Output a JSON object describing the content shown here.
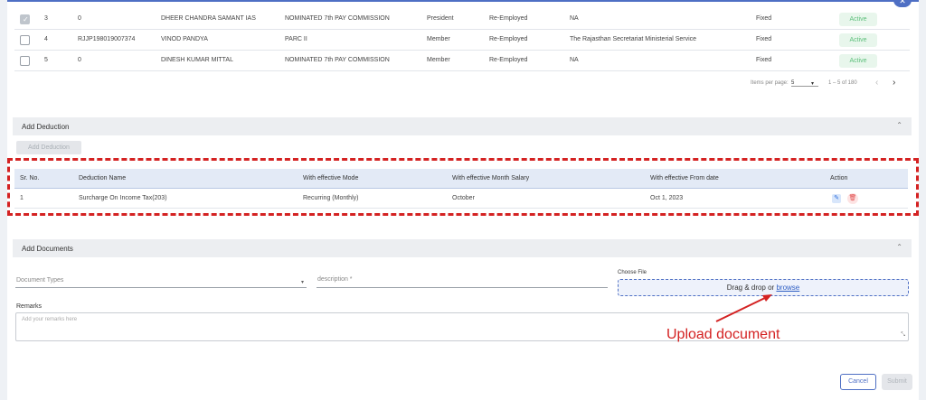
{
  "members_table": {
    "rows": [
      {
        "sr": "3",
        "id": "0",
        "name": "DHEER CHANDRA SAMANT IAS",
        "nominated": "NOMINATED 7th PAY COMMISSION",
        "role": "President",
        "employment": "Re-Employed",
        "service": "NA",
        "pay": "Fixed",
        "status": "Active",
        "checked": true
      },
      {
        "sr": "4",
        "id": "RJJP198019007374",
        "name": "VINOD PANDYA",
        "nominated": "PARC II",
        "role": "Member",
        "employment": "Re-Employed",
        "service": "The Rajasthan Secretariat Ministerial Service",
        "pay": "Fixed",
        "status": "Active",
        "checked": false
      },
      {
        "sr": "5",
        "id": "0",
        "name": "DINESH KUMAR MITTAL",
        "nominated": "NOMINATED 7th PAY COMMISSION",
        "role": "Member",
        "employment": "Re-Employed",
        "service": "NA",
        "pay": "Fixed",
        "status": "Active",
        "checked": false
      }
    ]
  },
  "paginator": {
    "items_label": "Items per page:",
    "page_size": "5",
    "range": "1 – 5 of 180",
    "prev": "‹",
    "next": "›"
  },
  "deduction": {
    "section_title": "Add Deduction",
    "add_button": "Add Deduction",
    "headers": {
      "sr": "Sr. No.",
      "name": "Deduction Name",
      "mode": "With effective Mode",
      "month": "With effective Month Salary",
      "from": "With effective From date",
      "action": "Action"
    },
    "rows": [
      {
        "sr": "1",
        "name": "Surcharge On Income Tax(203)",
        "mode": "Recurring (Monthly)",
        "month": "October",
        "from": "Oct 1, 2023"
      }
    ]
  },
  "documents": {
    "section_title": "Add Documents",
    "doc_type_placeholder": "Document Types",
    "description_placeholder": "description *",
    "choose_file_label": "Choose File",
    "drop_text": "Drag & drop or ",
    "browse_link": "browse",
    "remarks_label": "Remarks",
    "remarks_placeholder": "Add your remarks here"
  },
  "annotation": {
    "text": "Upload document",
    "color": "#d42222"
  },
  "actions": {
    "cancel": "Cancel",
    "submit": "Submit"
  },
  "icons": {
    "edit": "edit-icon",
    "delete": "delete-icon",
    "collapse": "chevron-up-icon",
    "dropdown": "caret-down-icon"
  },
  "colors": {
    "accent": "#4e6fc4",
    "active_badge": "#5cbf7a",
    "annotation": "#d42222"
  }
}
